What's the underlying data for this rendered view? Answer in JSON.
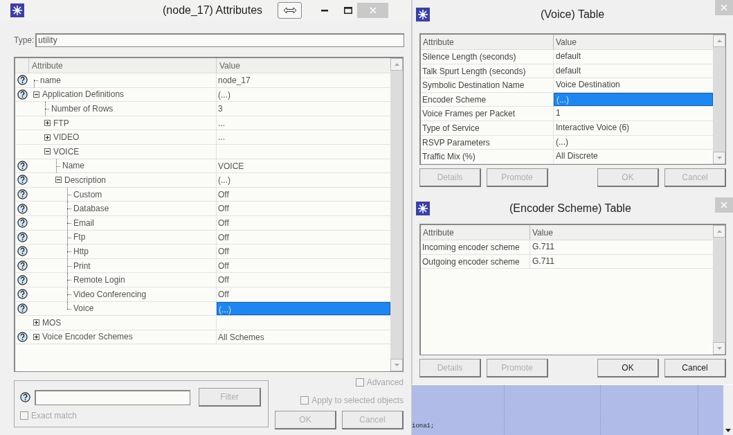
{
  "attributes_window": {
    "title": "(node_17) Attributes",
    "type_label": "Type:",
    "type_value": "utility",
    "columns": [
      "Attribute",
      "Value"
    ],
    "rows": [
      {
        "attribute": "name",
        "value": "node_17",
        "help": true,
        "selected": false
      },
      {
        "attribute": "Application Definitions",
        "value": "(...)",
        "help": true,
        "expanded": true,
        "selected": false,
        "children": [
          {
            "attribute": "Number of Rows",
            "value": "3",
            "help": false,
            "selected": false
          },
          {
            "attribute": "FTP",
            "value": "...",
            "help": false,
            "expanded": false,
            "selected": false
          },
          {
            "attribute": "VIDEO",
            "value": "...",
            "help": false,
            "expanded": false,
            "selected": false
          },
          {
            "attribute": "VOICE",
            "help": false,
            "expanded": true,
            "selected": false,
            "children": [
              {
                "attribute": "Name",
                "value": "VOICE",
                "help": true,
                "selected": false
              },
              {
                "attribute": "Description",
                "value": "(...)",
                "help": true,
                "expanded": true,
                "selected": false,
                "children": [
                  {
                    "attribute": "Custom",
                    "value": "Off",
                    "help": true,
                    "selected": false
                  },
                  {
                    "attribute": "Database",
                    "value": "Off",
                    "help": true,
                    "selected": false
                  },
                  {
                    "attribute": "Email",
                    "value": "Off",
                    "help": true,
                    "selected": false
                  },
                  {
                    "attribute": "Ftp",
                    "value": "Off",
                    "help": true,
                    "selected": false
                  },
                  {
                    "attribute": "Http",
                    "value": "Off",
                    "help": true,
                    "selected": false
                  },
                  {
                    "attribute": "Print",
                    "value": "Off",
                    "help": true,
                    "selected": false
                  },
                  {
                    "attribute": "Remote Login",
                    "value": "Off",
                    "help": true,
                    "selected": false
                  },
                  {
                    "attribute": "Video Conferencing",
                    "value": "Off",
                    "help": true,
                    "selected": false
                  },
                  {
                    "attribute": "Voice",
                    "value": "(...)",
                    "help": true,
                    "selected": true
                  }
                ]
              }
            ]
          }
        ]
      },
      {
        "attribute": "MOS",
        "help": false,
        "expanded": false,
        "selected": false
      },
      {
        "attribute": "Voice Encoder Schemes",
        "value": "All Schemes",
        "help": true,
        "expanded": false,
        "selected": false
      }
    ],
    "filter_button": {
      "label": "Filter",
      "disabled": true
    },
    "exact_match": {
      "label": "Exact match",
      "checked": false,
      "disabled": true
    },
    "advanced": {
      "label": "Advanced",
      "checked": false,
      "disabled": true
    },
    "apply_to_selected": {
      "label": "Apply to selected objects",
      "checked": false,
      "disabled": true
    },
    "buttons": [
      {
        "label": "OK",
        "disabled": true
      },
      {
        "label": "Cancel",
        "disabled": true
      }
    ]
  },
  "voice_table_window": {
    "title": "(Voice) Table",
    "columns": [
      "Attribute",
      "Value"
    ],
    "rows": [
      {
        "attribute": "Silence Length (seconds)",
        "value": "default",
        "selected": false
      },
      {
        "attribute": "Talk Spurt Length (seconds)",
        "value": "default",
        "selected": false
      },
      {
        "attribute": "Symbolic Destination Name",
        "value": "Voice Destination",
        "selected": false
      },
      {
        "attribute": "Encoder Scheme",
        "value": "(...)",
        "selected": true
      },
      {
        "attribute": "Voice Frames per Packet",
        "value": "1",
        "selected": false
      },
      {
        "attribute": "Type of Service",
        "value": "Interactive Voice (6)",
        "selected": false
      },
      {
        "attribute": "RSVP Parameters",
        "value": "(...)",
        "selected": false
      },
      {
        "attribute": "Traffic Mix (%)",
        "value": "All Discrete",
        "selected": false
      }
    ],
    "buttons": [
      {
        "label": "Details",
        "disabled": true
      },
      {
        "label": "Promote",
        "disabled": true
      },
      {
        "label": "OK",
        "disabled": true
      },
      {
        "label": "Cancel",
        "disabled": true
      }
    ]
  },
  "encoder_table_window": {
    "title": "(Encoder Scheme) Table",
    "columns": [
      "Attribute",
      "Value"
    ],
    "rows": [
      {
        "attribute": "Incoming encoder scheme",
        "value": "G.711",
        "selected": false
      },
      {
        "attribute": "Outgoing encoder scheme",
        "value": "G.711",
        "selected": false
      }
    ],
    "buttons": [
      {
        "label": "Details",
        "disabled": true
      },
      {
        "label": "Promote",
        "disabled": true
      },
      {
        "label": "OK",
        "disabled": false
      },
      {
        "label": "Cancel",
        "disabled": false
      }
    ]
  },
  "background_editor": {
    "code_text": "iona1;"
  }
}
